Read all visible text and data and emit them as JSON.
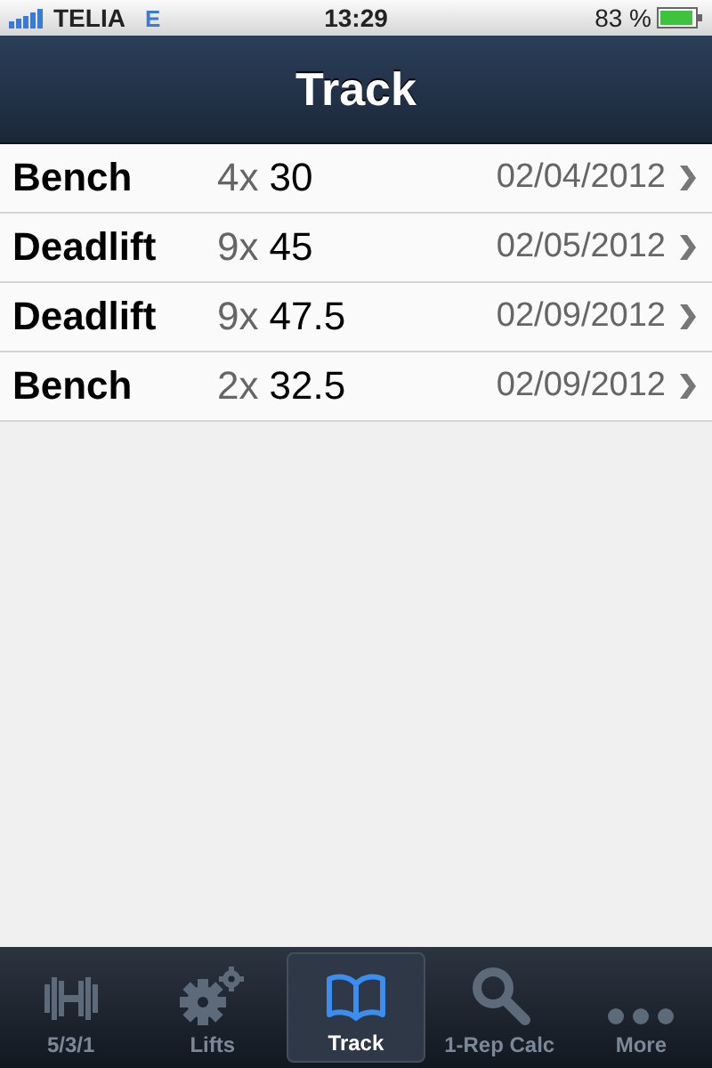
{
  "status_bar": {
    "carrier": "TELIA",
    "network": "E",
    "time": "13:29",
    "battery": "83 %"
  },
  "nav_bar": {
    "title": "Track"
  },
  "entries": [
    {
      "lift": "Bench",
      "reps": "4x",
      "weight": "30",
      "date": "02/04/2012"
    },
    {
      "lift": "Deadlift",
      "reps": "9x",
      "weight": "45",
      "date": "02/05/2012"
    },
    {
      "lift": "Deadlift",
      "reps": "9x",
      "weight": "47.5",
      "date": "02/09/2012"
    },
    {
      "lift": "Bench",
      "reps": "2x",
      "weight": "32.5",
      "date": "02/09/2012"
    }
  ],
  "tabs": [
    {
      "kind": "barbell",
      "label": "5/3/1",
      "selected": false
    },
    {
      "kind": "gears",
      "label": "Lifts",
      "selected": false
    },
    {
      "kind": "book",
      "label": "Track",
      "selected": true
    },
    {
      "kind": "search",
      "label": "1-Rep Calc",
      "selected": false
    },
    {
      "kind": "more",
      "label": "More",
      "selected": false
    }
  ]
}
